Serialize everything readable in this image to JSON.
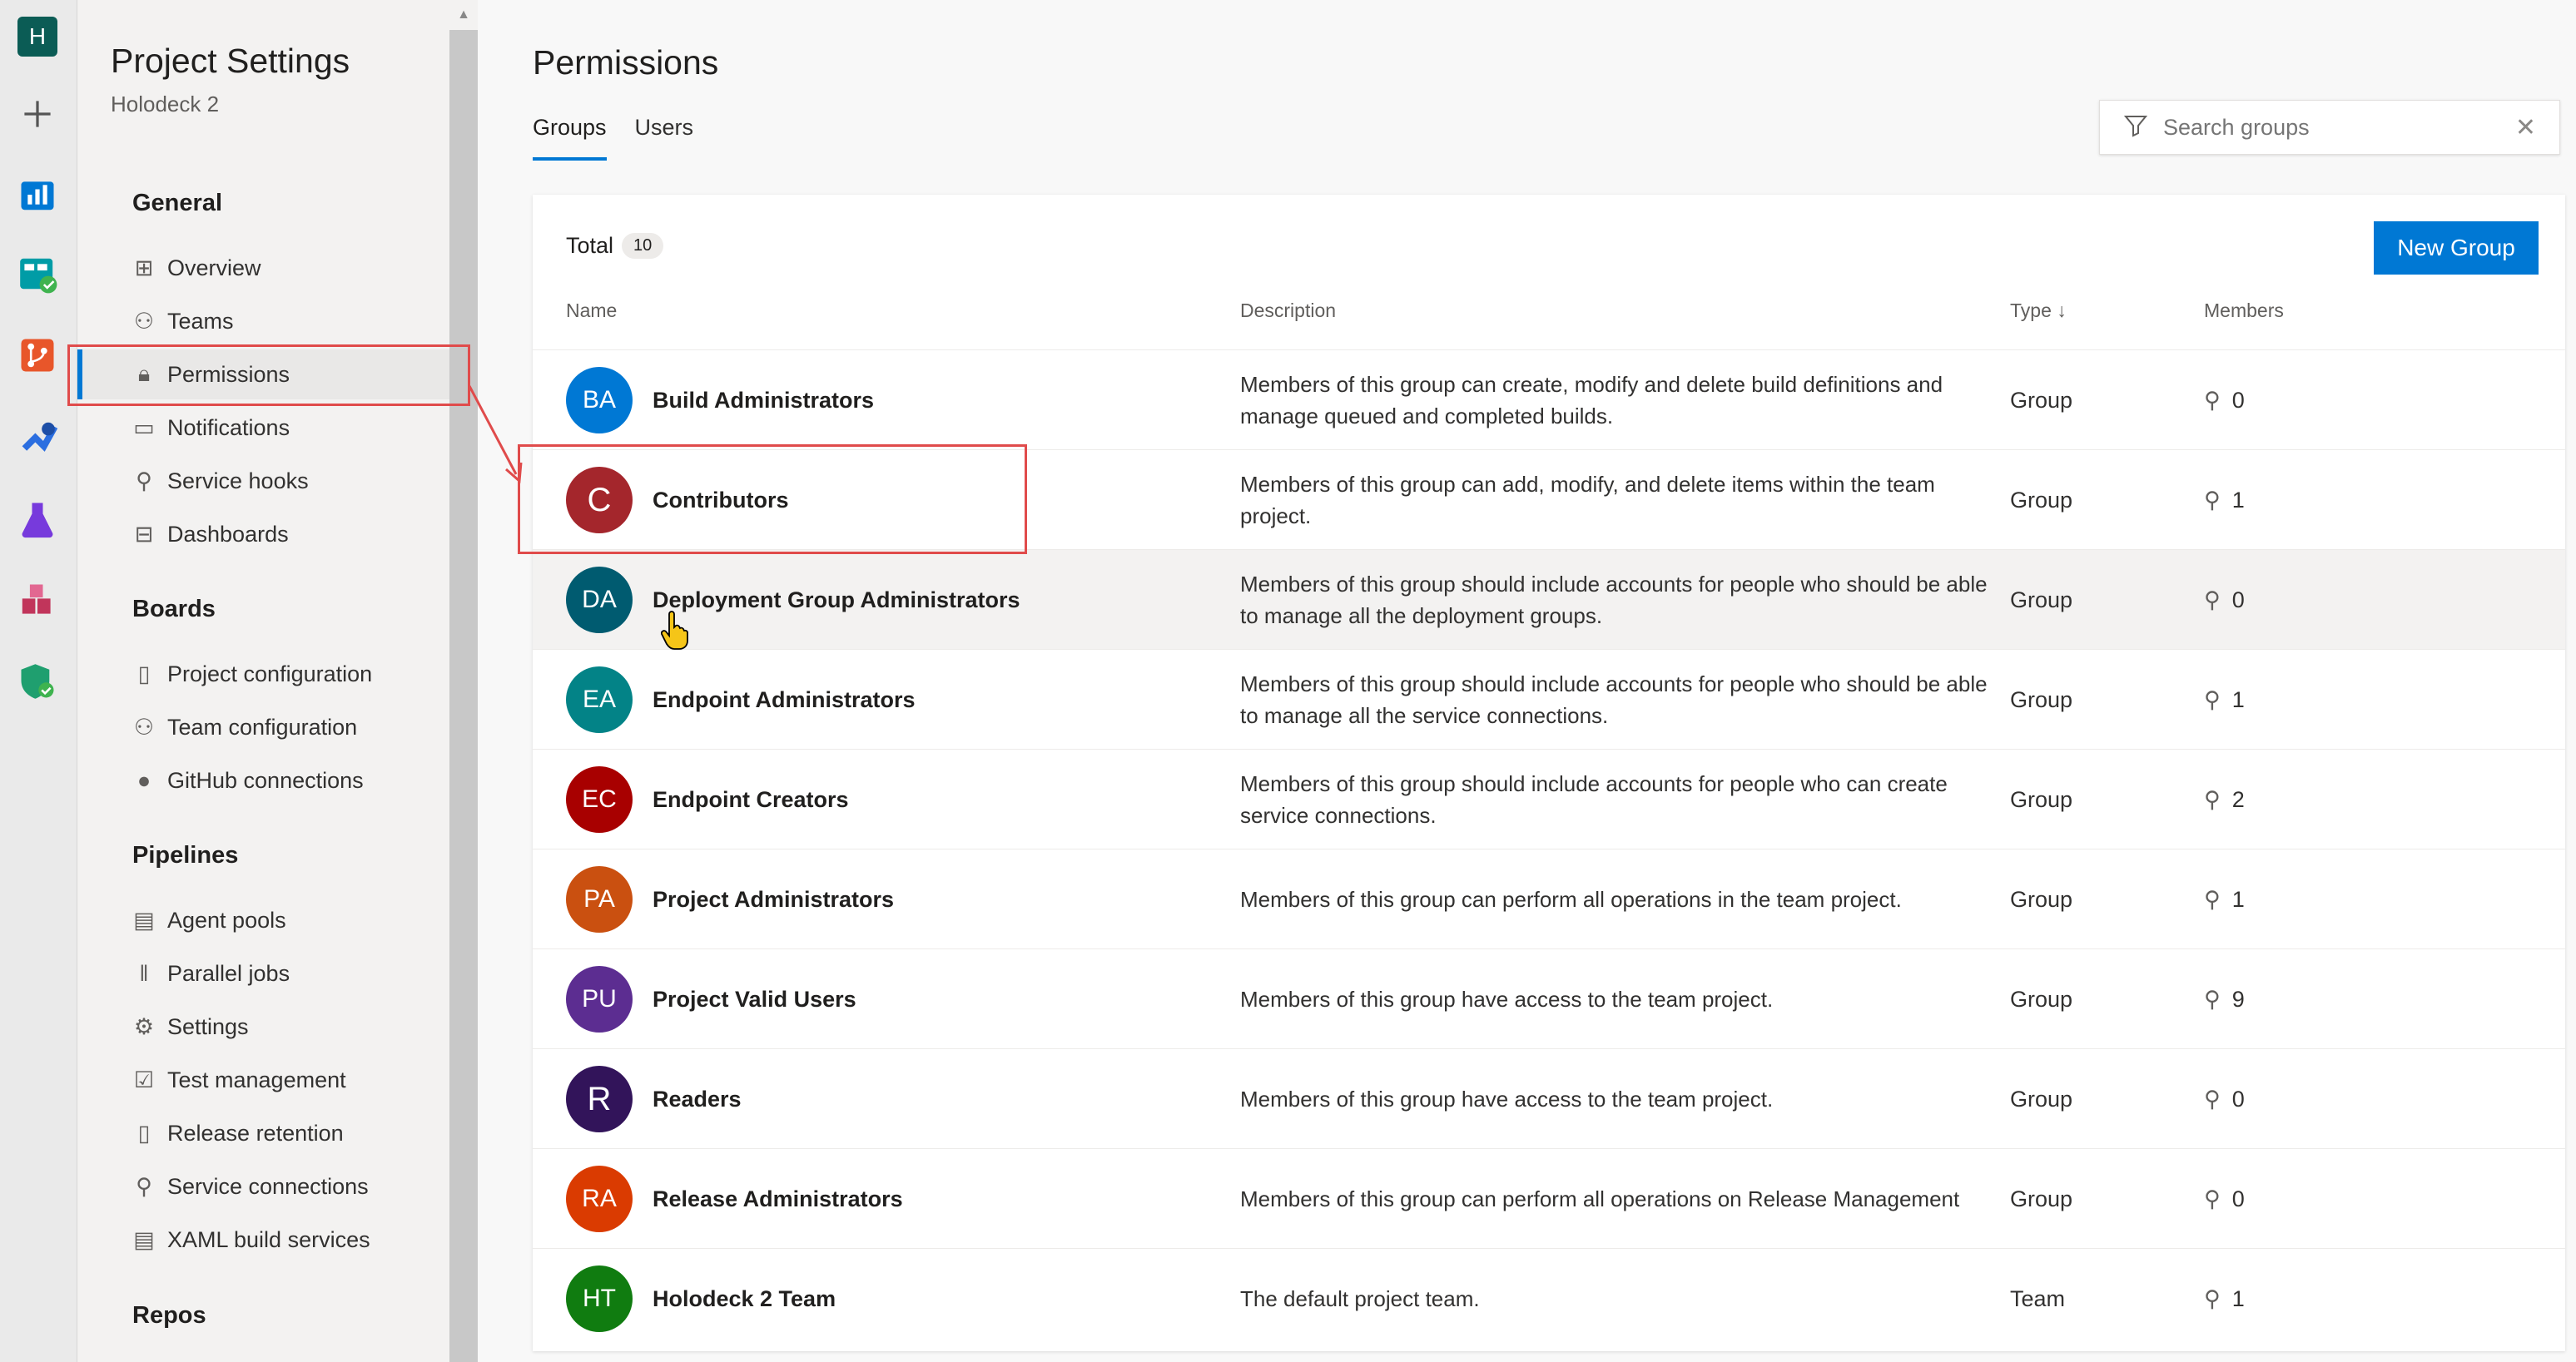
{
  "rail": {
    "org_initial": "H",
    "icons": [
      "add-icon",
      "overview-icon",
      "boards-icon",
      "repos-icon",
      "pipelines-icon",
      "test-plans-icon",
      "artifacts-icon",
      "security-icon"
    ]
  },
  "nav": {
    "title": "Project Settings",
    "subtitle": "Holodeck 2",
    "sections": {
      "general": "General",
      "boards": "Boards",
      "pipelines": "Pipelines",
      "repos": "Repos"
    },
    "general_items": [
      "Overview",
      "Teams",
      "Permissions",
      "Notifications",
      "Service hooks",
      "Dashboards"
    ],
    "boards_items": [
      "Project configuration",
      "Team configuration",
      "GitHub connections"
    ],
    "pipelines_items": [
      "Agent pools",
      "Parallel jobs",
      "Settings",
      "Test management",
      "Release retention",
      "Service connections",
      "XAML build services"
    ],
    "selected": "Permissions"
  },
  "main": {
    "title": "Permissions",
    "tabs": [
      "Groups",
      "Users"
    ],
    "active_tab": "Groups",
    "search": {
      "placeholder": "Search groups"
    },
    "total_label": "Total",
    "total_count": "10",
    "new_group_label": "New Group",
    "columns": {
      "name": "Name",
      "description": "Description",
      "type": "Type",
      "type_sort": "↓",
      "members": "Members"
    },
    "groups": [
      {
        "initials": "BA",
        "name": "Build Administrators",
        "description": "Members of this group can create, modify and delete build definitions and manage queued and completed builds.",
        "type": "Group",
        "members": "0",
        "color": "#0078d4"
      },
      {
        "initials": "C",
        "name": "Contributors",
        "description": "Members of this group can add, modify, and delete items within the team project.",
        "type": "Group",
        "members": "1",
        "color": "#a4262c"
      },
      {
        "initials": "DA",
        "name": "Deployment Group Administrators",
        "description": "Members of this group should include accounts for people who should be able to manage all the deployment groups.",
        "type": "Group",
        "members": "0",
        "color": "#005b70"
      },
      {
        "initials": "EA",
        "name": "Endpoint Administrators",
        "description": "Members of this group should include accounts for people who should be able to manage all the service connections.",
        "type": "Group",
        "members": "1",
        "color": "#038387"
      },
      {
        "initials": "EC",
        "name": "Endpoint Creators",
        "description": "Members of this group should include accounts for people who can create service connections.",
        "type": "Group",
        "members": "2",
        "color": "#a80000"
      },
      {
        "initials": "PA",
        "name": "Project Administrators",
        "description": "Members of this group can perform all operations in the team project.",
        "type": "Group",
        "members": "1",
        "color": "#ca5010"
      },
      {
        "initials": "PU",
        "name": "Project Valid Users",
        "description": "Members of this group have access to the team project.",
        "type": "Group",
        "members": "9",
        "color": "#5c2d91"
      },
      {
        "initials": "R",
        "name": "Readers",
        "description": "Members of this group have access to the team project.",
        "type": "Group",
        "members": "0",
        "color": "#32145a"
      },
      {
        "initials": "RA",
        "name": "Release Administrators",
        "description": "Members of this group can perform all operations on Release Management",
        "type": "Group",
        "members": "0",
        "color": "#da3b01"
      },
      {
        "initials": "HT",
        "name": "Holodeck 2 Team",
        "description": "The default project team.",
        "type": "Team",
        "members": "1",
        "color": "#107c10"
      }
    ]
  }
}
